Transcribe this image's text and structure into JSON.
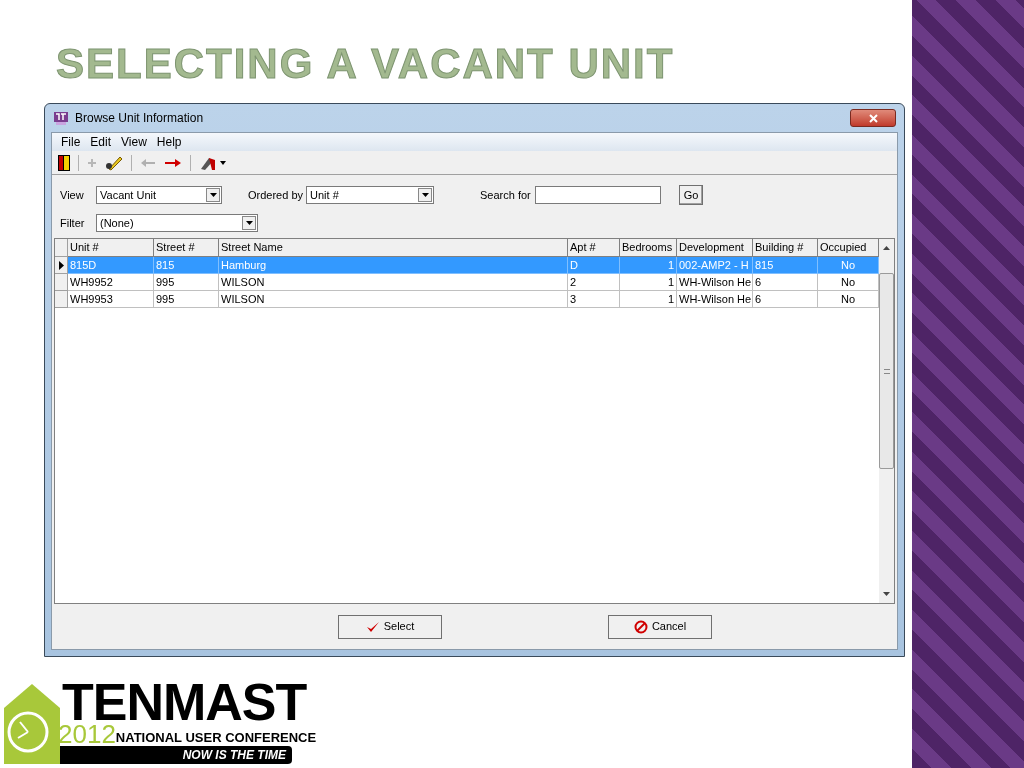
{
  "slide_title": "SELECTING A VACANT UNIT",
  "window": {
    "title": "Browse Unit Information"
  },
  "menu": [
    "File",
    "Edit",
    "View",
    "Help"
  ],
  "filters": {
    "view_label": "View",
    "view_value": "Vacant Unit",
    "ordered_label": "Ordered by",
    "ordered_value": "Unit #",
    "search_label": "Search for",
    "go_button": "Go",
    "filter_label": "Filter",
    "filter_value": "(None)"
  },
  "table": {
    "columns": [
      "Unit #",
      "Street #",
      "Street Name",
      "Apt #",
      "Bedrooms",
      "Development",
      "Building #",
      "Occupied"
    ],
    "rows": [
      {
        "selected": true,
        "cells": [
          "815D",
          "815",
          "Hamburg",
          "D",
          "1",
          "002-AMP2 - H",
          "815",
          "No"
        ]
      },
      {
        "selected": false,
        "cells": [
          "WH9952",
          "995",
          "WILSON",
          "2",
          "1",
          "WH-Wilson He",
          "6",
          "No"
        ]
      },
      {
        "selected": false,
        "cells": [
          "WH9953",
          "995",
          "WILSON",
          "3",
          "1",
          "WH-Wilson He",
          "6",
          "No"
        ]
      }
    ]
  },
  "buttons": [
    "Select",
    "Cancel"
  ],
  "logo": {
    "name": "TENMAST",
    "year": "2012",
    "subtitle": "NATIONAL USER CONFERENCE",
    "tagline": "NOW IS THE TIME"
  }
}
